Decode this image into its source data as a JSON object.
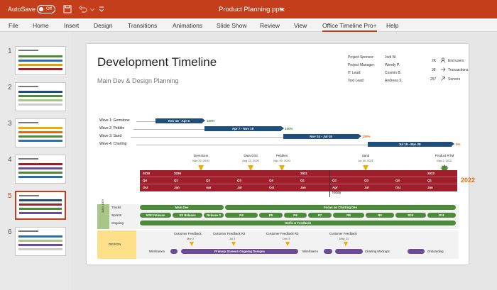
{
  "titlebar": {
    "autosave_label": "AutoSave",
    "autosave_state": "Off",
    "document_title": "Product Planning.pptx",
    "bg_color": "#c43e1c",
    "icons": [
      "save-icon",
      "undo-icon",
      "customize-icon",
      "dropdown-icon"
    ]
  },
  "menu": {
    "items": [
      "File",
      "Home",
      "Insert",
      "Design",
      "Transitions",
      "Animations",
      "Slide Show",
      "Review",
      "View",
      "Office Timeline Pro+",
      "Help"
    ],
    "active": "Office Timeline Pro+"
  },
  "thumbnails": {
    "numbers": [
      "1",
      "2",
      "3",
      "4",
      "5",
      "6"
    ],
    "selected": "5"
  },
  "slide": {
    "title": "Development Timeline",
    "subtitle": "Main Dev & Design Planning",
    "info": [
      {
        "label": "Project Sponsor:",
        "value": "Jodi W."
      },
      {
        "label": "Project Manager:",
        "value": "Wendy P."
      },
      {
        "label": "IT Lead:",
        "value": "Cosmin B."
      },
      {
        "label": "Test Lead:",
        "value": "Andreea S."
      }
    ],
    "stats": [
      {
        "value": "2K",
        "label": "End users",
        "icon": "users-icon"
      },
      {
        "value": "38",
        "label": "Transactions",
        "icon": "arrow-right-icon"
      },
      {
        "value": "257",
        "label": "Servers",
        "icon": "arrow-up-right-icon"
      }
    ],
    "waves": [
      {
        "label": "Wave 1: Gemstone",
        "range": "Nov 16 - Apr 5",
        "pct": "100%",
        "pct_color": "#4e8a3b"
      },
      {
        "label": "Wave 2: Pebble",
        "range": "Apr 7 - Nov 19",
        "pct": "100%",
        "pct_color": "#4e8a3b"
      },
      {
        "label": "Wave 3: Sand",
        "range": "Nov 24 - Jul 16",
        "pct": "100%",
        "pct_color": "#e36c0a"
      },
      {
        "label": "Wave 4: Charting",
        "range": "Jul 19 - Mar 28",
        "pct": "0%",
        "pct_color": "#e36c0a"
      }
    ],
    "milestones": [
      {
        "name": "Gemstone",
        "date": "Mar 29, 2020"
      },
      {
        "name": "Data Grid",
        "date": "Aug 23, 2020"
      },
      {
        "name": "Pebbles",
        "date": "Nov 29, 2020"
      },
      {
        "name": "Sand",
        "date": "Jul 18, 2021"
      },
      {
        "name": "Product RTM",
        "date": "Mar 2, 2022"
      }
    ],
    "scale": {
      "years": [
        "2019",
        "2020",
        "2021",
        "2022"
      ],
      "quarters": [
        "Q4",
        "Q1",
        "Q2",
        "Q3",
        "Q4",
        "Q1",
        "Q2",
        "Q3",
        "Q4",
        "Q1"
      ],
      "months": [
        "Oct",
        "Jan",
        "Apr",
        "Jul",
        "Oct",
        "Jan",
        "Apr",
        "Jul",
        "Oct",
        "Jan"
      ],
      "end_year": "2022",
      "today_label": "Today"
    },
    "main_dev": {
      "head": "MAIN DEV",
      "tracks_label": "Tracks",
      "sprints_label": "Sprints",
      "ongoing_label": "Ongoing",
      "tracks": [
        "Main Dev",
        "Focus on Charting Dev"
      ],
      "sprints": [
        "MSP Release",
        "SS Release",
        "Release 3",
        "R4",
        "R5",
        "R6",
        "R7",
        "R8",
        "R9",
        "R10",
        "R11"
      ],
      "ongoing": "Hotfix & Feedback"
    },
    "design": {
      "head": "DESIGN",
      "feedback": [
        {
          "label": "Customer Feedback",
          "date": "Mar 2"
        },
        {
          "label": "Customer Feedback R2",
          "date": "Jul 1"
        },
        {
          "label": "Customer Feedback R3",
          "date": "Dec 3"
        },
        {
          "label": "Customer Feedback",
          "date": "May 21"
        }
      ],
      "items": [
        "Wireframes",
        "Primary Screens Ongoing Designs",
        "Wireframes",
        "Charting Mockups",
        "Onboarding"
      ]
    }
  }
}
